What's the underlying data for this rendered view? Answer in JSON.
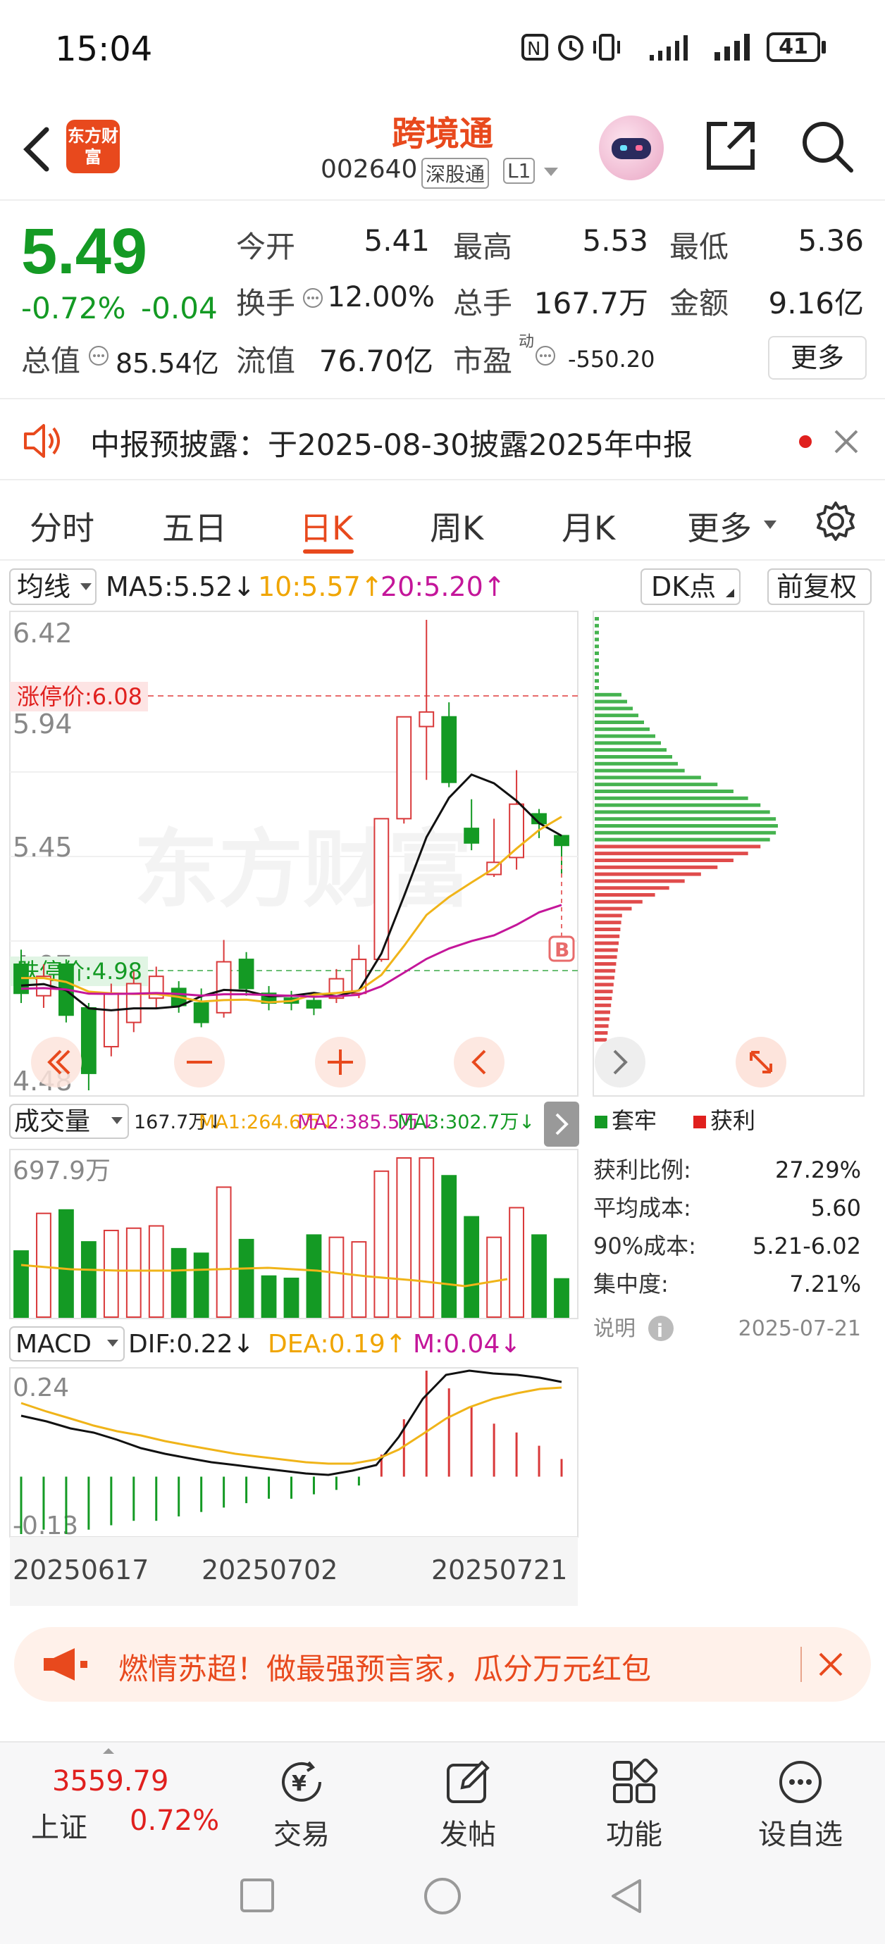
{
  "status_bar": {
    "time": "15:04",
    "battery": "41"
  },
  "header": {
    "logo_text": "东方财富",
    "stock_name": "跨境通",
    "stock_code": "002640",
    "tag_market": "深股通",
    "tag_level": "L1"
  },
  "quote": {
    "price": "5.49",
    "change_pct": "-0.72%",
    "change_abs": "-0.04",
    "open_label": "今开",
    "open": "5.41",
    "high_label": "最高",
    "high": "5.53",
    "low_label": "最低",
    "low": "5.36",
    "turnover_label": "换手",
    "turnover": "12.00%",
    "volume_label": "总手",
    "volume": "167.7万",
    "amount_label": "金额",
    "amount": "9.16亿",
    "mktcap_label": "总值",
    "mktcap": "85.54亿",
    "float_label": "流值",
    "float": "76.70亿",
    "pe_label": "市盈",
    "pe_sup": "动",
    "pe": "-550.20",
    "more_button": "更多"
  },
  "notice": {
    "text": "中报预披露：于2025-08-30披露2025年中报"
  },
  "tabs": [
    "分时",
    "五日",
    "日K",
    "周K",
    "月K",
    "更多"
  ],
  "active_tab": "日K",
  "kline": {
    "indicator_select": "均线",
    "ma5": "MA5:5.52↓",
    "ma10": "10:5.57↑",
    "ma20": "20:5.20↑",
    "dk_button": "DK点",
    "adjust_button": "前复权",
    "y_labels": [
      "6.42",
      "5.94",
      "5.45",
      "4.97",
      "4.48"
    ],
    "limit_up": "涨停价:6.08",
    "limit_down": "跌停价:4.98",
    "watermark": "东方财富",
    "buy_marker": "B"
  },
  "volume_panel": {
    "select": "成交量",
    "vol": "167.7万↓",
    "ma1": "MA1:264.6万↓",
    "ma2": "MA2:385.5万↓",
    "ma3": "MA3:302.7万↓",
    "max_label": "697.9万"
  },
  "macd_panel": {
    "select": "MACD",
    "dif": "DIF:0.22↓",
    "dea": "DEA:0.19↑",
    "m": "M:0.04↓",
    "top_label": "0.24",
    "bottom_label": "-0.13",
    "dates": [
      "20250617",
      "20250702",
      "20250721"
    ]
  },
  "chip_panel": {
    "legend_trapped": "套牢",
    "legend_profit": "获利",
    "rows": [
      {
        "label": "获利比例:",
        "value": "27.29%"
      },
      {
        "label": "平均成本:",
        "value": "5.60"
      },
      {
        "label": "90%成本:",
        "value": "5.21-6.02"
      },
      {
        "label": "集中度:",
        "value": "7.21%"
      }
    ],
    "note_label": "说明",
    "date": "2025-07-21"
  },
  "chart_data": {
    "type": "candlestick",
    "y_range": [
      4.48,
      6.42
    ],
    "candles": [
      {
        "o": 5.0,
        "c": 4.88,
        "h": 5.06,
        "l": 4.84
      },
      {
        "o": 4.87,
        "c": 4.95,
        "h": 5.0,
        "l": 4.82
      },
      {
        "o": 5.0,
        "c": 4.79,
        "h": 5.02,
        "l": 4.76
      },
      {
        "o": 4.82,
        "c": 4.55,
        "h": 4.84,
        "l": 4.48
      },
      {
        "o": 4.66,
        "c": 4.88,
        "h": 4.92,
        "l": 4.62
      },
      {
        "o": 4.76,
        "c": 4.92,
        "h": 4.97,
        "l": 4.72
      },
      {
        "o": 4.86,
        "c": 4.95,
        "h": 4.99,
        "l": 4.82
      },
      {
        "o": 4.9,
        "c": 4.83,
        "h": 4.93,
        "l": 4.8
      },
      {
        "o": 4.84,
        "c": 4.76,
        "h": 4.9,
        "l": 4.74
      },
      {
        "o": 4.8,
        "c": 5.01,
        "h": 5.1,
        "l": 4.78
      },
      {
        "o": 5.02,
        "c": 4.9,
        "h": 5.05,
        "l": 4.87
      },
      {
        "o": 4.88,
        "c": 4.84,
        "h": 4.91,
        "l": 4.81
      },
      {
        "o": 4.86,
        "c": 4.84,
        "h": 4.89,
        "l": 4.81
      },
      {
        "o": 4.85,
        "c": 4.82,
        "h": 4.87,
        "l": 4.79
      },
      {
        "o": 4.86,
        "c": 4.94,
        "h": 4.98,
        "l": 4.84
      },
      {
        "o": 4.88,
        "c": 5.02,
        "h": 5.08,
        "l": 4.86
      },
      {
        "o": 5.02,
        "c": 5.6,
        "h": 5.6,
        "l": 5.01
      },
      {
        "o": 5.6,
        "c": 6.02,
        "h": 6.02,
        "l": 5.58
      },
      {
        "o": 5.98,
        "c": 6.04,
        "h": 6.42,
        "l": 5.76
      },
      {
        "o": 6.02,
        "c": 5.75,
        "h": 6.08,
        "l": 5.73
      },
      {
        "o": 5.56,
        "c": 5.5,
        "h": 5.68,
        "l": 5.47
      },
      {
        "o": 5.37,
        "c": 5.42,
        "h": 5.6,
        "l": 5.36
      },
      {
        "o": 5.44,
        "c": 5.66,
        "h": 5.8,
        "l": 5.39
      },
      {
        "o": 5.62,
        "c": 5.58,
        "h": 5.64,
        "l": 5.52
      },
      {
        "o": 5.53,
        "c": 5.49,
        "h": 5.53,
        "l": 5.36
      }
    ],
    "volume_wan": [
      290,
      455,
      470,
      330,
      380,
      390,
      400,
      300,
      280,
      570,
      340,
      180,
      170,
      360,
      350,
      330,
      640,
      698,
      698,
      620,
      440,
      350,
      480,
      360,
      167.7
    ],
    "macd_bars": [
      -0.13,
      -0.12,
      -0.13,
      -0.12,
      -0.11,
      -0.1,
      -0.1,
      -0.09,
      -0.08,
      -0.07,
      -0.06,
      -0.05,
      -0.05,
      -0.04,
      -0.03,
      -0.02,
      0.05,
      0.13,
      0.24,
      0.2,
      0.16,
      0.12,
      0.1,
      0.07,
      0.04
    ]
  },
  "promo": {
    "text": "燃情苏超！做最强预言家，瓜分万元红包"
  },
  "bottom_nav": {
    "index_value": "3559.79",
    "index_name": "上证",
    "index_pct": "0.72%",
    "items": [
      "交易",
      "发帖",
      "功能",
      "设自选"
    ]
  }
}
